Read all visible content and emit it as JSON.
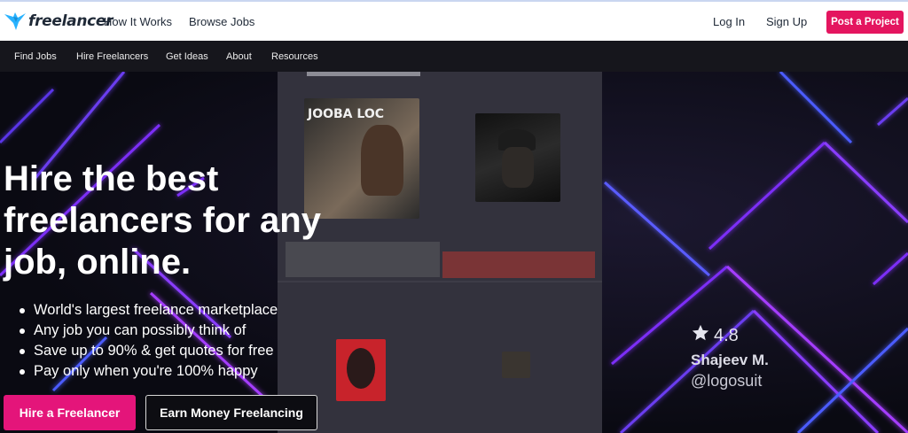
{
  "brand": {
    "logo_text": "freelancer",
    "logo_color": "#29b2fe"
  },
  "topnav": {
    "how_it_works": "How It Works",
    "browse_jobs": "Browse Jobs",
    "login": "Log In",
    "signup": "Sign Up",
    "post_project": "Post a Project"
  },
  "subnav": {
    "items": [
      "Find Jobs",
      "Hire Freelancers",
      "Get Ideas",
      "About",
      "Resources"
    ]
  },
  "hero": {
    "headline": "Hire the best freelancers for any job, online.",
    "bullets": [
      "World's largest freelance marketplace",
      "Any job you can possibly think of",
      "Save up to 90% & get quotes for free",
      "Pay only when you're 100% happy"
    ],
    "hire_button": "Hire a Freelancer",
    "earn_button": "Earn Money Freelancing",
    "cover_title": "JOOBA LOC"
  },
  "showcase": {
    "rating": "4.8",
    "name": "Shajeev M.",
    "handle": "@logosuit"
  },
  "colors": {
    "accent_pink": "#e4155f",
    "neon_purple": "#7b2ff7",
    "neon_blue": "#4b5cff"
  },
  "icons": {
    "logo": "bird-icon",
    "star": "star-icon"
  }
}
